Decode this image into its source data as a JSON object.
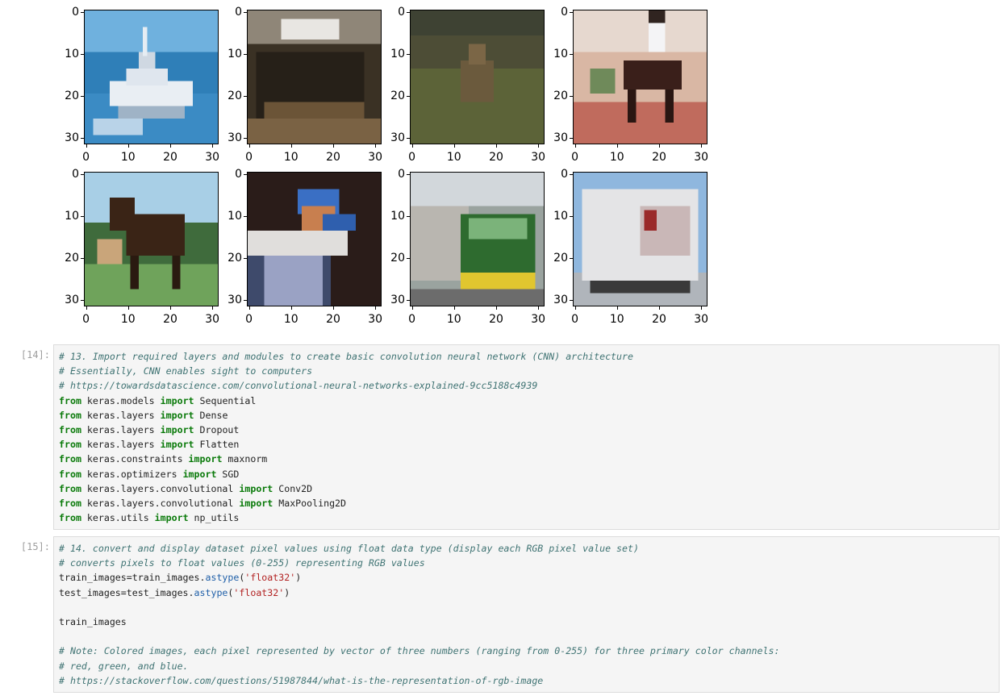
{
  "figure": {
    "y_ticks": [
      "0",
      "10",
      "20",
      "30"
    ],
    "x_ticks": [
      "0",
      "10",
      "20",
      "30"
    ],
    "images": [
      {
        "subject": "ship"
      },
      {
        "subject": "cat"
      },
      {
        "subject": "deer"
      },
      {
        "subject": "horse with rider"
      },
      {
        "subject": "horse"
      },
      {
        "subject": "bird"
      },
      {
        "subject": "truck"
      },
      {
        "subject": "truck"
      }
    ]
  },
  "cells": [
    {
      "prompt": "[14]:",
      "lines": [
        [
          {
            "t": "# 13. Import required layers and modules to create basic convolution neural network (CNN) architecture",
            "c": "cm"
          }
        ],
        [
          {
            "t": "# Essentially, CNN enables sight to computers",
            "c": "cm"
          }
        ],
        [
          {
            "t": "# https://towardsdatascience.com/convolutional-neural-networks-explained-9cc5188c4939",
            "c": "cm"
          }
        ],
        [
          {
            "t": "from",
            "c": "kw"
          },
          {
            "t": " keras.models ",
            "c": ""
          },
          {
            "t": "import",
            "c": "kw"
          },
          {
            "t": " Sequential",
            "c": ""
          }
        ],
        [
          {
            "t": "from",
            "c": "kw"
          },
          {
            "t": " keras.layers ",
            "c": ""
          },
          {
            "t": "import",
            "c": "kw"
          },
          {
            "t": " Dense",
            "c": ""
          }
        ],
        [
          {
            "t": "from",
            "c": "kw"
          },
          {
            "t": " keras.layers ",
            "c": ""
          },
          {
            "t": "import",
            "c": "kw"
          },
          {
            "t": " Dropout",
            "c": ""
          }
        ],
        [
          {
            "t": "from",
            "c": "kw"
          },
          {
            "t": " keras.layers ",
            "c": ""
          },
          {
            "t": "import",
            "c": "kw"
          },
          {
            "t": " Flatten",
            "c": ""
          }
        ],
        [
          {
            "t": "from",
            "c": "kw"
          },
          {
            "t": " keras.constraints ",
            "c": ""
          },
          {
            "t": "import",
            "c": "kw"
          },
          {
            "t": " maxnorm",
            "c": ""
          }
        ],
        [
          {
            "t": "from",
            "c": "kw"
          },
          {
            "t": " keras.optimizers ",
            "c": ""
          },
          {
            "t": "import",
            "c": "kw"
          },
          {
            "t": " SGD",
            "c": ""
          }
        ],
        [
          {
            "t": "from",
            "c": "kw"
          },
          {
            "t": " keras.layers.convolutional ",
            "c": ""
          },
          {
            "t": "import",
            "c": "kw"
          },
          {
            "t": " Conv2D",
            "c": ""
          }
        ],
        [
          {
            "t": "from",
            "c": "kw"
          },
          {
            "t": " keras.layers.convolutional ",
            "c": ""
          },
          {
            "t": "import",
            "c": "kw"
          },
          {
            "t": " MaxPooling2D",
            "c": ""
          }
        ],
        [
          {
            "t": "from",
            "c": "kw"
          },
          {
            "t": " keras.utils ",
            "c": ""
          },
          {
            "t": "import",
            "c": "kw"
          },
          {
            "t": " np_utils",
            "c": ""
          }
        ]
      ]
    },
    {
      "prompt": "[15]:",
      "lines": [
        [
          {
            "t": "# 14. convert and display dataset pixel values using float data type (display each RGB pixel value set)",
            "c": "cm"
          }
        ],
        [
          {
            "t": "# converts pixels to float values (0-255) representing RGB values",
            "c": "cm"
          }
        ],
        [
          {
            "t": "train_images=train_images.",
            "c": ""
          },
          {
            "t": "astype",
            "c": "fn"
          },
          {
            "t": "(",
            "c": ""
          },
          {
            "t": "'float32'",
            "c": "str"
          },
          {
            "t": ")",
            "c": ""
          }
        ],
        [
          {
            "t": "test_images=test_images.",
            "c": ""
          },
          {
            "t": "astype",
            "c": "fn"
          },
          {
            "t": "(",
            "c": ""
          },
          {
            "t": "'float32'",
            "c": "str"
          },
          {
            "t": ")",
            "c": ""
          }
        ],
        [],
        [
          {
            "t": "train_images",
            "c": ""
          }
        ],
        [],
        [
          {
            "t": "# Note: Colored images, each pixel represented by vector of three numbers (ranging from 0-255) for three primary color channels:",
            "c": "cm"
          }
        ],
        [
          {
            "t": "# red, green, and blue.",
            "c": "cm"
          }
        ],
        [
          {
            "t": "# https://stackoverflow.com/questions/51987844/what-is-the-representation-of-rgb-image",
            "c": "cm"
          }
        ]
      ]
    }
  ]
}
